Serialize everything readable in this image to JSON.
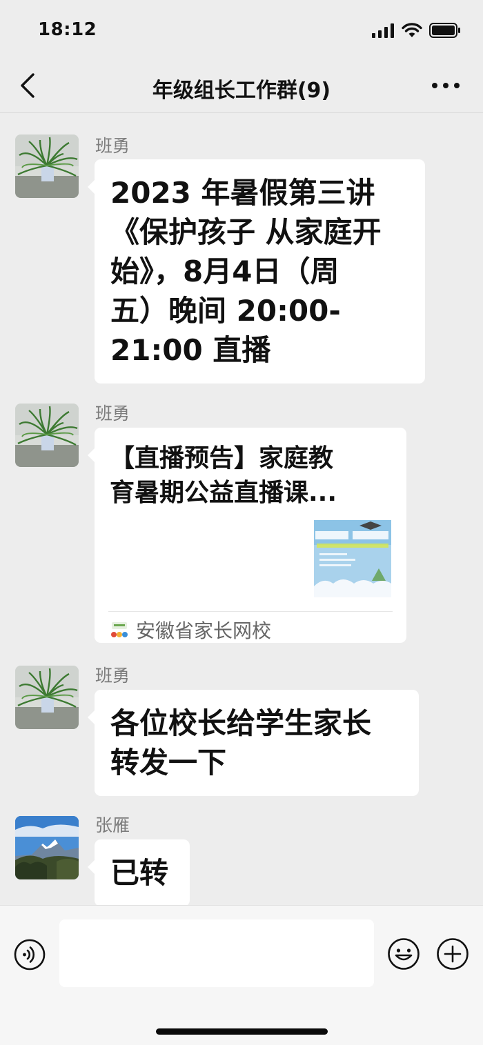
{
  "status_bar": {
    "time": "18:12"
  },
  "header": {
    "title": "年级组长工作群(9)"
  },
  "messages": [
    {
      "sender": "班勇",
      "text_lines": [
        "2023 年暑假第三讲",
        "《保护孩子 从家庭开",
        "始》，8月4日（周",
        "五）晚间 20:00-",
        "21:00 直播"
      ]
    },
    {
      "sender": "班勇",
      "card_title_lines": [
        "【直播预告】家庭教",
        "育暑期公益直播课..."
      ],
      "card_source": "安徽省家长网校"
    },
    {
      "sender": "班勇",
      "text_lines": [
        "各位校长给学生家长",
        "转发一下"
      ]
    },
    {
      "sender": "张雁",
      "text_lines": [
        "已转"
      ]
    }
  ],
  "colors": {
    "chat_background": "#ededed",
    "bubble": "#ffffff",
    "sender_name": "#7c7c7c"
  },
  "icons": {
    "back": "chevron-left-icon",
    "more": "more-dots-icon",
    "voice": "voice-icon",
    "emoji": "emoji-icon",
    "plus": "plus-icon",
    "signal": "signal-icon",
    "wifi": "wifi-icon",
    "battery": "battery-icon"
  }
}
